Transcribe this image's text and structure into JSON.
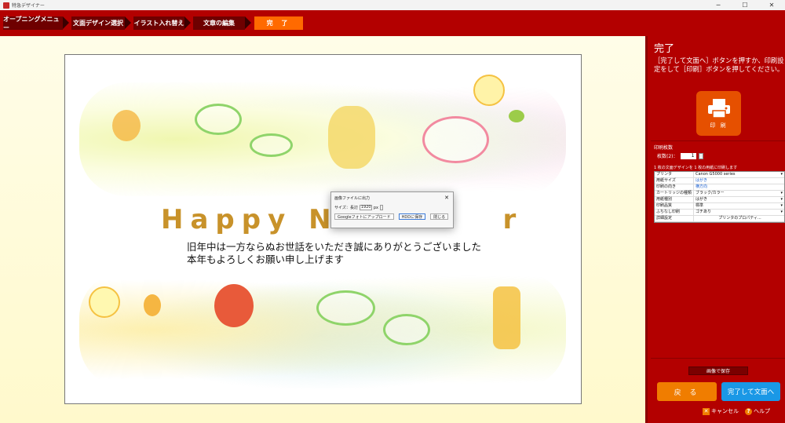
{
  "window": {
    "title": "特急デザイナー",
    "minimize": "─",
    "maximize": "☐",
    "close": "✕"
  },
  "steps": [
    {
      "label": "オープニングメニュー"
    },
    {
      "label": "文面デザイン選択"
    },
    {
      "label": "イラスト入れ替え"
    },
    {
      "label": "文章の編集"
    },
    {
      "label": "完 了"
    }
  ],
  "card": {
    "happy_text": "Happy  N",
    "happy_tail": "r",
    "greeting_line1": "旧年中は一方ならぬお世話をいただき誠にありがとうございました",
    "greeting_line2": "本年もよろしくお願い申し上げます"
  },
  "dialog": {
    "title": "画像ファイルに出力",
    "close": "✕",
    "size_label": "サイズ：長辺",
    "size_value": "1920",
    "size_unit": "px",
    "btn_google": "Googleフォトにアップロード",
    "btn_save": "HDDに保存",
    "btn_close": "閉じる"
  },
  "panel": {
    "title": "完了",
    "description": "［完了して文面へ］ボタンを押すか、印刷設定をして［印刷］ボタンを押してください。",
    "print_label": "印 刷",
    "copies_title": "印刷枚数",
    "copies_label": "枚数(2)：",
    "copies_value": "1",
    "settings_note": "1 枚の文面デザインを 1 枚の用紙に印刷します",
    "settings": [
      {
        "key": "プリンタ",
        "value": "Canon G5000 series",
        "style": "plain"
      },
      {
        "key": "用紙サイズ",
        "value": "はがき",
        "style": "blue"
      },
      {
        "key": "印刷の向き",
        "value": "横方向",
        "style": "blue"
      },
      {
        "key": "カートリッジの種類",
        "value": "ブラック/カラー",
        "style": "plain"
      },
      {
        "key": "用紙種別",
        "value": "はがき",
        "style": "plain"
      },
      {
        "key": "印刷品質",
        "value": "標準",
        "style": "plain"
      },
      {
        "key": "ふちなし印刷",
        "value": "ゴチあり",
        "style": "plain"
      },
      {
        "key": "詳細設定",
        "value": "プリンタのプロパティ...",
        "style": "center"
      }
    ],
    "save_image": "画像で保存",
    "back": "戻 る",
    "done": "完了して文面へ",
    "cancel": "キャンセル",
    "help": "ヘルプ"
  },
  "colors": {
    "brand_red": "#b30000",
    "dark_red": "#6e0000",
    "orange": "#f07d00",
    "blue": "#1a98e6"
  }
}
